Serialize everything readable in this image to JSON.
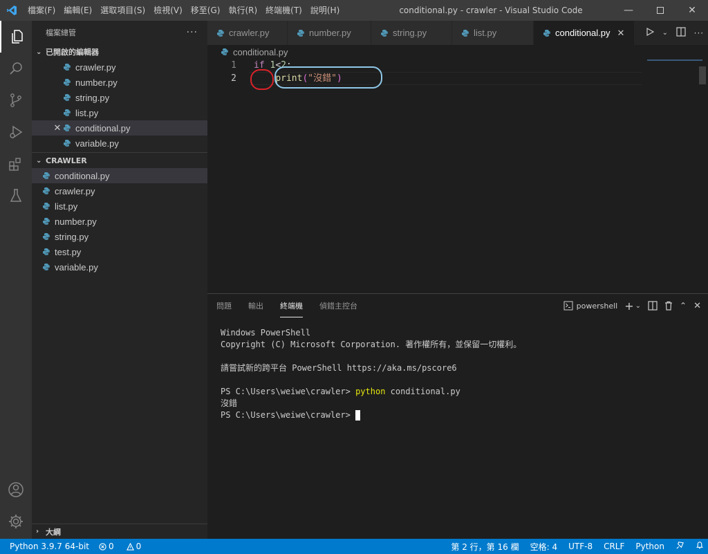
{
  "window": {
    "title": "conditional.py - crawler - Visual Studio Code",
    "menu": [
      "檔案(F)",
      "編輯(E)",
      "選取項目(S)",
      "檢視(V)",
      "移至(G)",
      "執行(R)",
      "終端機(T)",
      "說明(H)"
    ]
  },
  "sidebar": {
    "header": "檔案總管",
    "open_editors_label": "已開啟的編輯器",
    "open_editors": [
      "crawler.py",
      "number.py",
      "string.py",
      "list.py",
      "conditional.py",
      "variable.py"
    ],
    "folder_label": "CRAWLER",
    "files": [
      "conditional.py",
      "crawler.py",
      "list.py",
      "number.py",
      "string.py",
      "test.py",
      "variable.py"
    ],
    "outline_label": "大綱"
  },
  "tabs": [
    "crawler.py",
    "number.py",
    "string.py",
    "list.py",
    "conditional.py"
  ],
  "breadcrumb": "conditional.py",
  "code": {
    "line1_no": "1",
    "line2_no": "2",
    "line1_kw": "if",
    "line1_num1": "1",
    "line1_op": "<",
    "line1_num2": "2",
    "line1_colon": ":",
    "line2_fn": "print",
    "line2_open": "(",
    "line2_str": "\"沒錯\"",
    "line2_close": ")"
  },
  "panel": {
    "tabs": [
      "問題",
      "輸出",
      "終端機",
      "偵錯主控台"
    ],
    "shell": "powershell",
    "terminal": {
      "l1": "Windows PowerShell",
      "l2": "Copyright (C) Microsoft Corporation. 著作權所有，並保留一切權利。",
      "l3": "請嘗試新的跨平台 PowerShell https://aka.ms/pscore6",
      "l4_prompt": "PS C:\\Users\\weiwe\\crawler> ",
      "l4_cmd": "python",
      "l4_args": " conditional.py",
      "l5": "沒錯",
      "l6_prompt": "PS C:\\Users\\weiwe\\crawler> "
    }
  },
  "status": {
    "python": "Python 3.9.7 64-bit",
    "errors": "0",
    "warnings": "0",
    "position": "第 2 行，第 16 欄",
    "indent": "空格: 4",
    "encoding": "UTF-8",
    "eol": "CRLF",
    "language": "Python"
  },
  "colors": {
    "accent": "#007acc",
    "python_icon": "#519aba",
    "annotation_red": "#d9232a",
    "annotation_blue": "#8fc8e8"
  }
}
